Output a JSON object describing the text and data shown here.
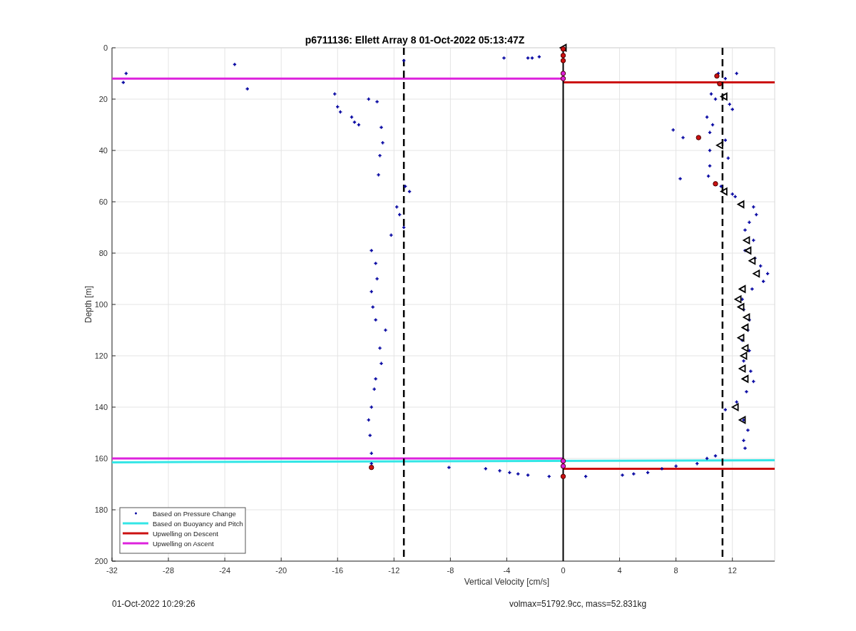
{
  "chart_data": {
    "type": "scatter",
    "title": "p6711136: Ellett Array 8 01-Oct-2022 05:13:47Z",
    "xlabel": "Vertical Velocity [cm/s]",
    "ylabel": "Depth [m]",
    "xlim": [
      -32,
      15
    ],
    "ylim": [
      200,
      0
    ],
    "xticks": [
      -32,
      -28,
      -24,
      -20,
      -16,
      -12,
      -8,
      -4,
      0,
      4,
      8,
      12
    ],
    "yticks": [
      0,
      20,
      40,
      60,
      80,
      100,
      120,
      140,
      160,
      180,
      200
    ],
    "grid": true,
    "legend": true,
    "series": [
      {
        "name": "Based on Pressure Change",
        "type": "scatter",
        "color": "#0000a0",
        "x": [
          -31,
          -31.2,
          -23.3,
          -22.4,
          -16.2,
          -16,
          -15.8,
          -15,
          -14.8,
          -14.5,
          -13.8,
          -13.2,
          -11.3,
          -4.2,
          -2.5,
          -2.2,
          -1.7,
          -12.9,
          -12.8,
          -13,
          -13.1,
          -11.2,
          -10.9,
          -11.8,
          -11.6,
          -11.3,
          -12.2,
          -13.6,
          -13.3,
          -13.2,
          -13.6,
          -13.5,
          -13.3,
          -12.6,
          -13,
          -12.9,
          -13.3,
          -13.4,
          -13.6,
          -13.8,
          -13.7,
          -13.6,
          -13.6,
          -8.1,
          -5.5,
          -4.5,
          -3.8,
          -3.2,
          -2.5,
          -1,
          1.6,
          4.2,
          5,
          6,
          7,
          8,
          9.5,
          10.2,
          10.8,
          11,
          11.5,
          12.3,
          10.5,
          10.8,
          11.8,
          12,
          10.2,
          10.6,
          7.8,
          8.5,
          10.4,
          11.5,
          10.4,
          11.7,
          10.4,
          8.3,
          10.3,
          11.2,
          12,
          12.2,
          13.5,
          13.7,
          13.2,
          12.9,
          13.5,
          12.9,
          13.6,
          14,
          14.5,
          14.2,
          13.4,
          12.7,
          12.8,
          13.2,
          13.1,
          12.7,
          13.2,
          12.8,
          13.3,
          13.5,
          13,
          12.3,
          11.5,
          12.8,
          13.1,
          12.8,
          12.9
        ],
        "values": [
          10,
          13.5,
          6.5,
          16,
          18,
          23,
          25,
          27,
          29,
          30,
          20,
          21,
          5,
          4,
          4,
          4,
          3.5,
          31,
          37,
          42,
          49.5,
          54,
          56,
          62,
          65,
          70,
          73,
          79,
          84,
          90,
          95,
          101,
          106,
          110,
          117,
          123,
          129,
          133,
          140,
          145,
          151,
          158,
          162,
          163.5,
          164,
          164.8,
          165.5,
          166,
          166.5,
          167,
          167,
          166.5,
          166,
          165.5,
          164,
          163,
          162,
          160,
          159,
          10,
          12,
          10,
          18,
          20,
          22,
          24,
          27,
          30,
          32,
          35,
          33,
          36,
          40,
          43,
          46,
          51,
          50,
          54,
          57,
          58,
          62,
          65,
          68,
          71,
          75,
          79,
          82,
          85,
          88,
          91,
          94,
          98,
          102,
          106,
          110,
          114,
          118,
          122,
          126,
          130,
          134,
          138,
          141,
          145,
          149,
          153,
          156
        ]
      },
      {
        "name": "Based on Buoyancy and Pitch",
        "type": "line",
        "color": "#33e6e6",
        "x": [
          -32,
          15
        ],
        "values": [
          161.5,
          160.7
        ]
      },
      {
        "name": "Upwelling on Descent",
        "type": "line",
        "color": "#cc1111",
        "x": [
          0,
          15
        ],
        "values": [
          13.5,
          13.5
        ]
      },
      {
        "type": "line",
        "color": "#cc1111",
        "x": [
          0,
          15
        ],
        "values": [
          164,
          164
        ]
      },
      {
        "name": "Upwelling on Ascent",
        "type": "line",
        "color": "#dd22dd",
        "x": [
          -32,
          0
        ],
        "values": [
          12,
          12
        ]
      },
      {
        "type": "line",
        "color": "#dd22dd",
        "x": [
          -32,
          0
        ],
        "values": [
          160,
          160
        ]
      },
      {
        "type": "line",
        "color": "#000000",
        "x": [
          0,
          0
        ],
        "values": [
          0,
          200
        ]
      },
      {
        "type": "scatter",
        "marker": "triangle",
        "color": "#000000",
        "x": [
          0,
          11.4,
          11.1,
          11.4,
          12.6,
          13,
          13.1,
          13.4,
          13.7,
          12.7,
          12.4,
          12.6,
          13,
          12.9,
          12.6,
          12.9,
          12.8,
          12.7,
          12.9,
          12.2,
          12.7
        ],
        "values": [
          0,
          19,
          38,
          56,
          61,
          75,
          79,
          83,
          88,
          94,
          98,
          101,
          105,
          109,
          113,
          117,
          120,
          125,
          129,
          140,
          145
        ]
      },
      {
        "type": "scatter",
        "marker": "circle",
        "color": "#cc1111",
        "x": [
          0,
          0,
          0,
          10.9,
          11.1,
          9.6,
          10.8,
          -13.6,
          0
        ],
        "values": [
          0.5,
          3,
          5,
          11,
          14,
          35,
          53,
          163.5,
          167
        ]
      },
      {
        "type": "scatter",
        "marker": "circle",
        "color": "#dd22dd",
        "x": [
          0,
          0,
          0,
          0
        ],
        "values": [
          10,
          12,
          161,
          163
        ]
      }
    ],
    "ref_lines": [
      {
        "axis": "x",
        "value": -11.3,
        "color": "#000000"
      },
      {
        "axis": "x",
        "value": 11.3,
        "color": "#000000"
      }
    ]
  },
  "footer": {
    "timestamp": "01-Oct-2022 10:29:26",
    "summary": "volmax=51792.9cc, mass=52.831kg"
  }
}
